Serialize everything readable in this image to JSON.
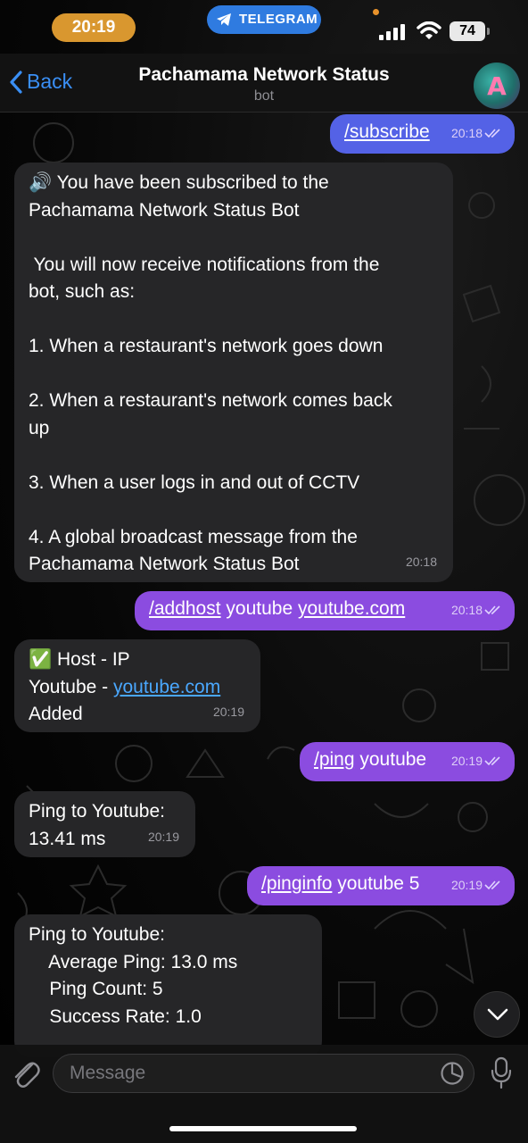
{
  "status_bar": {
    "time": "20:19",
    "app_pill": "TELEGRAM",
    "battery": "74"
  },
  "header": {
    "back_label": "Back",
    "title": "Pachamama Network Status",
    "subtitle": "bot",
    "avatar_letter": "A"
  },
  "messages": [
    {
      "dir": "out",
      "time": "20:18",
      "text": [
        {
          "cmd": "/subscribe"
        }
      ]
    },
    {
      "dir": "in",
      "time": "20:18",
      "lines": [
        "🔊 You have been subscribed to the",
        "Pachamama Network Status Bot",
        "",
        " You will now receive notifications from the",
        "bot, such as:",
        "",
        "1. When a restaurant's network goes down",
        "",
        "2. When a restaurant's network comes back",
        "up",
        "",
        "3. When a user logs in and out of CCTV",
        "",
        "4. A global broadcast message from the",
        "Pachamama Network Status Bot"
      ]
    },
    {
      "dir": "out",
      "time": "20:18",
      "cmd": "/addhost",
      "rest": " youtube ",
      "link": "youtube.com"
    },
    {
      "dir": "in",
      "time": "20:19",
      "line1": "✅ Host - IP",
      "line2_pre": "Youtube - ",
      "line2_link": "youtube.com",
      "line3": "Added"
    },
    {
      "dir": "out",
      "time": "20:19",
      "cmd": "/ping",
      "rest": " youtube"
    },
    {
      "dir": "in",
      "time": "20:19",
      "lines": [
        "Ping to Youtube:",
        "13.41 ms"
      ]
    },
    {
      "dir": "out",
      "time": "20:19",
      "cmd": "/pinginfo",
      "rest": " youtube 5"
    },
    {
      "dir": "in",
      "lines": [
        "Ping to Youtube:",
        "    Average Ping: 13.0 ms",
        "    Ping Count: 5",
        "    Success Rate: 1.0"
      ]
    }
  ],
  "composer": {
    "placeholder": "Message"
  },
  "colors": {
    "outgoing_bubble": "#8b4ce0",
    "outgoing_bubble_first": "#5462e6",
    "incoming_bubble": "#262628",
    "accent": "#3a8ff5",
    "time_pill": "#d9972f",
    "telegram_pill": "#2f7be0"
  }
}
